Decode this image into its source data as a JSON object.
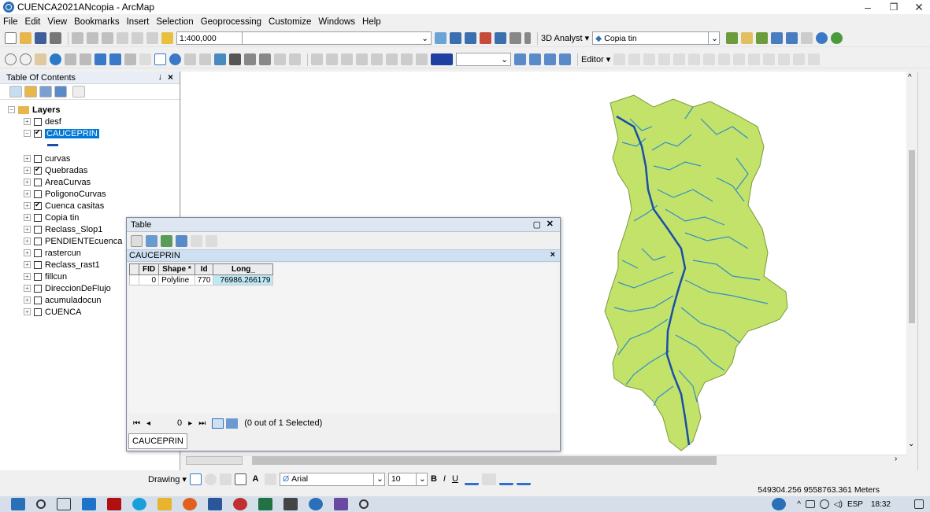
{
  "window": {
    "title": "CUENCA2021ANcopia - ArcMap",
    "minimize": "–",
    "maximize": "❐",
    "close": "✕"
  },
  "menu": [
    "File",
    "Edit",
    "View",
    "Bookmarks",
    "Insert",
    "Selection",
    "Geoprocessing",
    "Customize",
    "Windows",
    "Help"
  ],
  "toolbar": {
    "scale": "1:400,000",
    "analyst_label": "3D Analyst ▾",
    "analyst_layer": "Copia tin",
    "editor_label": "Editor ▾"
  },
  "toc": {
    "title": "Table Of Contents",
    "pin": "↓",
    "close": "×",
    "root": "Layers",
    "layers": [
      {
        "name": "desf",
        "checked": false
      },
      {
        "name": "CAUCEPRIN",
        "checked": true,
        "selected": true
      },
      {
        "name": "curvas",
        "checked": false
      },
      {
        "name": "Quebradas",
        "checked": true
      },
      {
        "name": "AreaCurvas",
        "checked": false
      },
      {
        "name": "PoligonoCurvas",
        "checked": false
      },
      {
        "name": "Cuenca casitas",
        "checked": true
      },
      {
        "name": "Copia tin",
        "checked": false
      },
      {
        "name": "Reclass_Slop1",
        "checked": false
      },
      {
        "name": "PENDIENTEcuenca",
        "checked": false
      },
      {
        "name": "rastercun",
        "checked": false
      },
      {
        "name": "Reclass_rast1",
        "checked": false
      },
      {
        "name": "fillcun",
        "checked": false
      },
      {
        "name": "DireccionDeFlujo",
        "checked": false
      },
      {
        "name": "acumuladocun",
        "checked": false
      },
      {
        "name": "CUENCA",
        "checked": false
      }
    ]
  },
  "table_window": {
    "title": "Table",
    "table_name": "CAUCEPRIN",
    "columns": [
      "FID",
      "Shape *",
      "Id",
      "Long_"
    ],
    "rows": [
      [
        "0",
        "Polyline",
        "770",
        "76986.266179"
      ]
    ],
    "record": "0",
    "selection_status": "(0 out of 1 Selected)",
    "bottom_tab": "CAUCEPRIN"
  },
  "draw_toolbar": {
    "drawing_label": "Drawing ▾",
    "font": "Arial",
    "size": "10"
  },
  "status": {
    "coordinates": "549304.256  9558763.361 Meters"
  },
  "taskbar": {
    "language": "ESP",
    "time": "18:32"
  },
  "colors": {
    "basin_fill": "#c3e26a",
    "stream": "#2f8fc9",
    "main_channel": "#1a4fa8",
    "selection": "#0078d7"
  }
}
